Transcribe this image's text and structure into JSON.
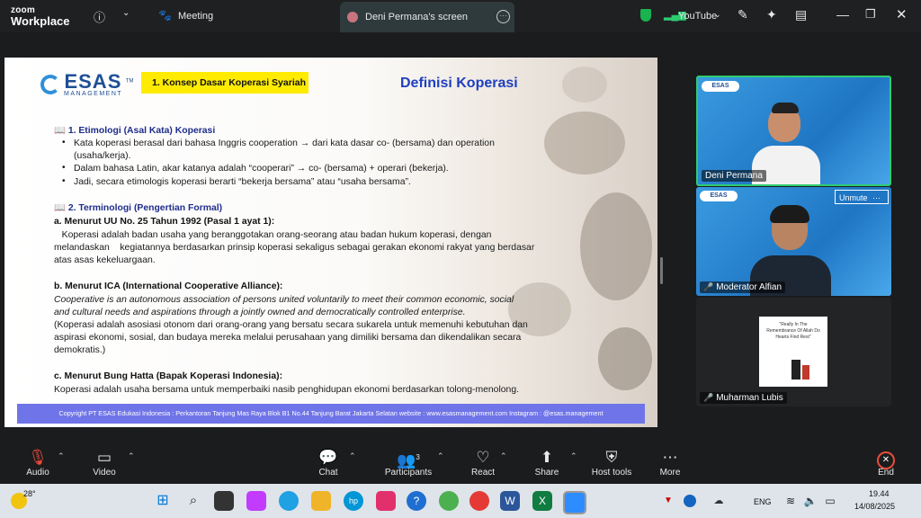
{
  "app": {
    "logo_line1": "zoom",
    "logo_line2": "Workplace"
  },
  "topbar": {
    "meeting_label": "Meeting",
    "screen_tab_label": "Deni Permana's screen",
    "youtube_label": "YouTube"
  },
  "slide": {
    "logo_text": "ESAS",
    "logo_tm": "TM",
    "logo_sub": "MANAGEMENT",
    "section_box": "1.   Konsep Dasar Koperasi Syariah",
    "title": "Definisi Koperasi",
    "h1": "📖 1. Etimologi (Asal Kata) Koperasi",
    "b1a": "Kata koperasi berasal dari bahasa Inggris cooperation → dari kata dasar co- (bersama) dan operation",
    "b1b": "(usaha/kerja).",
    "b2": "Dalam bahasa Latin, akar katanya adalah “cooperari” → co- (bersama) + operari (bekerja).",
    "b3": "Jadi, secara etimologis koperasi berarti “bekerja bersama” atau “usaha bersama”.",
    "h2": "📖 2. Terminologi (Pengertian Formal)",
    "a_title": "a. Menurut UU No. 25 Tahun 1992 (Pasal 1 ayat 1):",
    "a_1": "   Koperasi adalah badan usaha yang beranggotakan orang-seorang atau badan hukum koperasi, dengan",
    "a_2": "melandaskan    kegiatannya berdasarkan prinsip koperasi sekaligus sebagai gerakan ekonomi rakyat yang berdasar",
    "a_3": "atas asas kekeluargaan.",
    "b_title": "b. Menurut ICA (International Cooperative Alliance):",
    "b_1": "Cooperative is an autonomous association of persons united voluntarily to meet their common economic, social",
    "b_2": "and cultural needs and aspirations through a jointly owned and democratically controlled enterprise.",
    "b_3": "(Koperasi adalah asosiasi otonom dari orang-orang yang bersatu secara sukarela untuk memenuhi kebutuhan dan",
    "b_4": "aspirasi ekonomi, sosial, dan budaya mereka melalui perusahaan yang dimiliki bersama dan dikendalikan secara",
    "b_5": "demokratis.)",
    "c_title": "c. Menurut Bung Hatta (Bapak Koperasi Indonesia):",
    "c_1": "Koperasi adalah usaha bersama untuk memperbaiki nasib penghidupan ekonomi berdasarkan tolong-menolong.",
    "footer": "Copyright PT ESAS Edukasi Indonesia : Perkantoran Tanjung Mas Raya Blok B1 No.44 Tanjung Barat Jakarta Selatan website : www.esasmanagement.com Instagram : @esas.management"
  },
  "participants": [
    {
      "name": "Deni Permana"
    },
    {
      "name": "Moderator Alfian",
      "unmute_label": "Unmute"
    },
    {
      "name": "Muharman Lubis",
      "poster_text": "\"Really In The Remembrance Of Allah Do Hearts Find Rest\""
    }
  ],
  "toolbar": {
    "audio": "Audio",
    "video": "Video",
    "chat": "Chat",
    "participants": "Participants",
    "participants_count": "3",
    "react": "React",
    "share": "Share",
    "host_tools": "Host tools",
    "more": "More",
    "end": "End"
  },
  "taskbar": {
    "weather_temp": "28°",
    "lang": "ENG",
    "time": "19.44",
    "date": "14/08/2025"
  }
}
